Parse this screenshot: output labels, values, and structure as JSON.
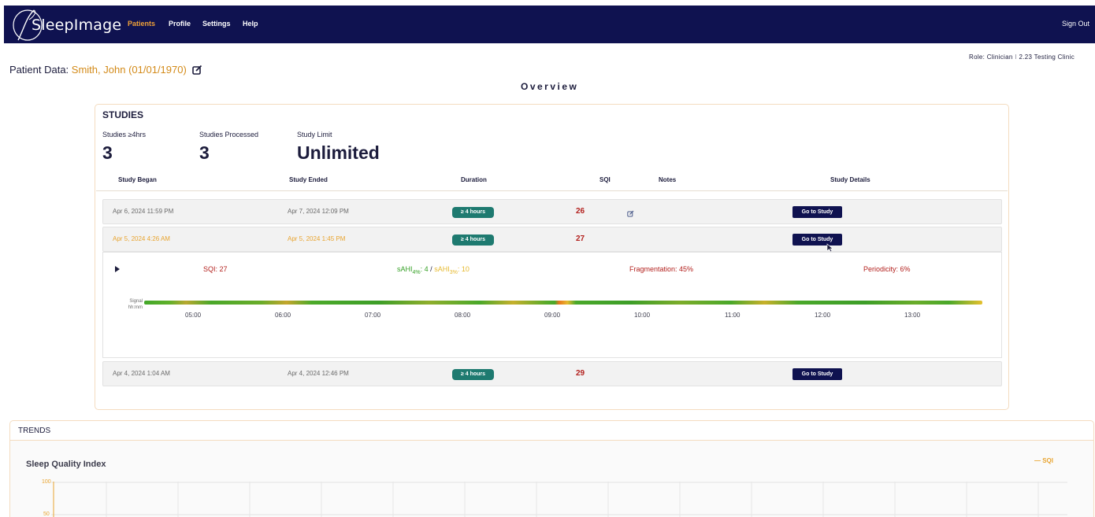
{
  "app": {
    "brand": "SleepImage",
    "nav": [
      "Patients",
      "Profile",
      "Settings",
      "Help"
    ],
    "active_nav": "Patients",
    "sign_out": "Sign Out"
  },
  "patient": {
    "label": "Patient Data:",
    "name": "Smith, John",
    "dob_open": "(",
    "dob": "01/01/1970",
    "dob_close": ")"
  },
  "role_line": "Role: Clinician  ⁝  2.23 Testing Clinic",
  "overview_title": "Overview",
  "studies": {
    "title": "STUDIES",
    "stats": [
      {
        "label": "Studies ≥4hrs",
        "value": "3"
      },
      {
        "label": "Studies Processed",
        "value": "3"
      },
      {
        "label": "Study Limit",
        "value": "Unlimited"
      }
    ],
    "columns": [
      "Study Began",
      "Study Ended",
      "Duration",
      "SQI",
      "Notes",
      "Study Details"
    ],
    "rows": [
      {
        "began": "Apr 6, 2024 11:59 PM",
        "ended": "Apr 7, 2024 12:09 PM",
        "duration": "≥ 4 hours",
        "sqi": "26",
        "has_note": true,
        "action": "Go to Study"
      },
      {
        "began": "Apr 5, 2024 4:26 AM",
        "ended": "Apr 5, 2024 1:45 PM",
        "duration": "≥ 4 hours",
        "sqi": "27",
        "has_note": false,
        "action": "Go to Study"
      },
      {
        "began": "Apr 4, 2024 1:04 AM",
        "ended": "Apr 4, 2024 12:46 PM",
        "duration": "≥ 4 hours",
        "sqi": "29",
        "has_note": false,
        "action": "Go to Study"
      }
    ],
    "detail": {
      "sqi": "SQI: 27",
      "sahi4_label": "sAHI",
      "sahi4_sub": "4%",
      "sahi4_val": ": 4",
      "sep": " / ",
      "sahi3_label": "sAHI",
      "sahi3_sub": "3%",
      "sahi3_val": ": 10",
      "fragmentation": "Fragmentation: 45%",
      "periodicity": "Periodicity: 6%",
      "signal_label": "Signal",
      "time_label": "hh:mm",
      "ticks": [
        "05:00",
        "06:00",
        "07:00",
        "08:00",
        "09:00",
        "10:00",
        "11:00",
        "12:00",
        "13:00"
      ]
    }
  },
  "trends": {
    "title": "TRENDS",
    "chart_title": "Sleep Quality Index",
    "legend": "— SQI",
    "y_ticks": [
      "100",
      "50"
    ]
  },
  "colors": {
    "navbar": "#0f1250",
    "accent_orange": "#d38a18",
    "badge_teal": "#1e7a70",
    "sqi_red": "#b3211e"
  }
}
